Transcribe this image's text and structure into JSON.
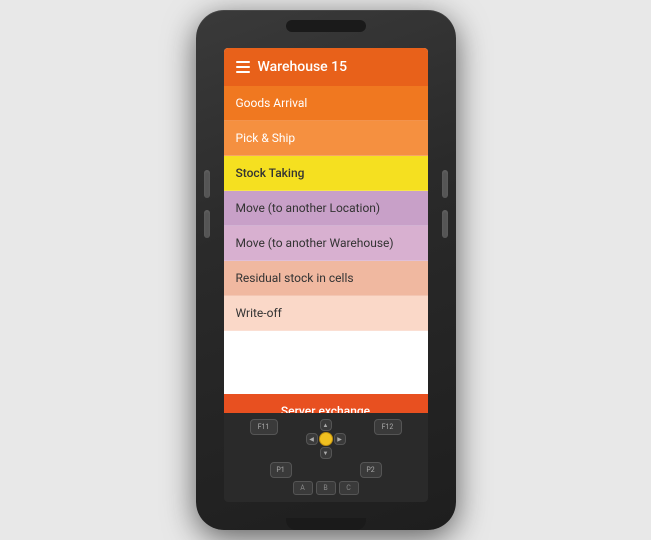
{
  "header": {
    "title": "Warehouse 15",
    "menu_icon": "hamburger"
  },
  "menu_items": [
    {
      "id": "goods-arrival",
      "label": "Goods Arrival",
      "color_class": "menu-item-goods-arrival"
    },
    {
      "id": "pick-ship",
      "label": "Pick & Ship",
      "color_class": "menu-item-pick-ship"
    },
    {
      "id": "stock-taking",
      "label": "Stock Taking",
      "color_class": "menu-item-stock-taking"
    },
    {
      "id": "move-location",
      "label": "Move (to another Location)",
      "color_class": "menu-item-move-location"
    },
    {
      "id": "move-warehouse",
      "label": "Move (to another Warehouse)",
      "color_class": "menu-item-move-warehouse"
    },
    {
      "id": "residual-stock",
      "label": "Residual stock in cells",
      "color_class": "menu-item-residual"
    },
    {
      "id": "write-off",
      "label": "Write-off",
      "color_class": "menu-item-writeoff"
    }
  ],
  "server_exchange": {
    "label": "Server exchange"
  },
  "keypad": {
    "f11": "F11",
    "f12": "F12",
    "p1": "P1",
    "p2": "P2",
    "nav_up": "▲",
    "nav_down": "▼",
    "nav_left": "◀",
    "nav_right": "▶",
    "nav_center": "",
    "key_a": "A",
    "key_b": "B",
    "key_c": "C"
  }
}
